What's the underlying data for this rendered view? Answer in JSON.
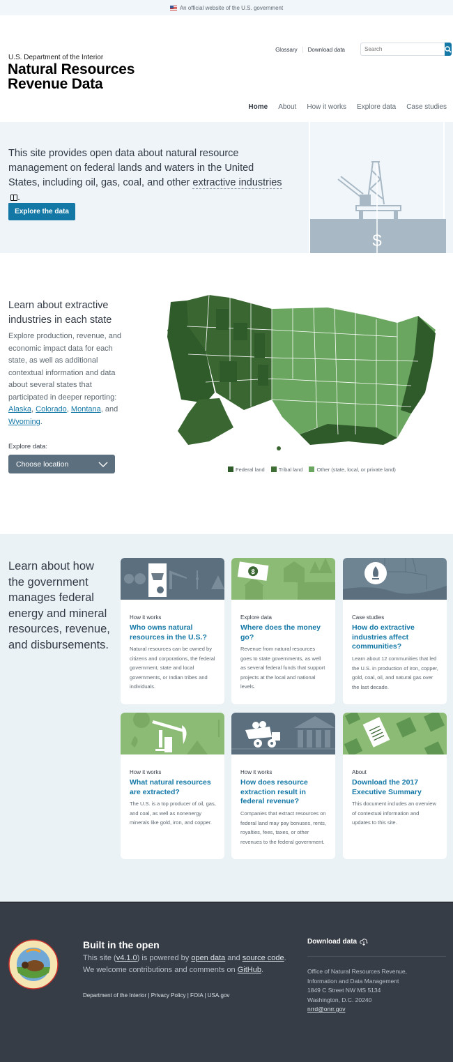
{
  "gov_banner": {
    "text": "An official website of the U.S. government"
  },
  "header": {
    "agency": "U.S. Department of the Interior",
    "title_line1": "Natural Resources",
    "title_line2": "Revenue Data",
    "utility_links": [
      "Glossary",
      "Download data"
    ],
    "search_placeholder": "Search",
    "nav": [
      {
        "label": "Home",
        "active": true
      },
      {
        "label": "About"
      },
      {
        "label": "How it works"
      },
      {
        "label": "Explore data"
      },
      {
        "label": "Case studies"
      }
    ]
  },
  "hero": {
    "text_before": "This site provides open data about natural resource management on federal lands and waters in the United States, including oil, gas, coal, and other ",
    "term": "extractive industries",
    "text_after": ".",
    "button": "Explore the data",
    "art_icon": "offshore-oil-rig-dollar"
  },
  "states": {
    "heading": "Learn about extractive industries in each state",
    "body_before": "Explore production, revenue, and economic impact data for each state, as well as additional contextual information and data about several states that participated in deeper reporting: ",
    "links": [
      "Alaska",
      "Colorado",
      "Montana",
      "Wyoming"
    ],
    "sep1": ", ",
    "sep2": ", ",
    "sep3": ", and ",
    "body_after": ".",
    "explore_label": "Explore data:",
    "select_value": "Choose location",
    "legend": [
      {
        "label": "Federal land",
        "color": "#2f5a2a"
      },
      {
        "label": "Tribal land",
        "color": "#3f6f35"
      },
      {
        "label": "Other (state, local, or private land)",
        "color": "#6aa660"
      }
    ]
  },
  "manage": {
    "heading": "Learn about how the government manages federal energy and mineral resources, revenue, and disbursements.",
    "cards": [
      {
        "category": "How it works",
        "title": "Who owns natural resources in the U.S.?",
        "desc": "Natural resources can be owned by citizens and corporations, the federal government, state and local governments, or Indian tribes and individuals."
      },
      {
        "category": "Explore data",
        "title": "Where does the money go?",
        "desc": "Revenue from natural resources goes to state governments, as well as several federal funds that support projects at the local and national levels."
      },
      {
        "category": "Case studies",
        "title": "How do extractive industries affect communities?",
        "desc": "Learn about 12 communities that led the U.S. in production of iron, copper, gold, coal, oil, and natural gas over the last decade."
      },
      {
        "category": "How it works",
        "title": "What natural resources are extracted?",
        "desc": "The U.S. is a top producer of oil, gas, and coal, as well as nonenergy minerals like gold, iron, and copper."
      },
      {
        "category": "How it works",
        "title": "How does resource extraction result in federal revenue?",
        "desc": "Companies that extract resources on federal land may pay bonuses, rents, royalties, fees, taxes, or other revenues to the federal government."
      },
      {
        "category": "About",
        "title": "Download the 2017 Executive Summary",
        "desc": "This document includes an overview of contextual information and updates to this site."
      }
    ]
  },
  "footer": {
    "built_title": "Built in the open",
    "built_1": "This site (",
    "version": "v4.1.0",
    "built_2": ") is powered by ",
    "open_data": "open data",
    "built_3": " and ",
    "source_code": "source code",
    "built_4": ". We welcome contributions and comments on ",
    "github": "GitHub",
    "built_5": ".",
    "links": [
      "Department of the Interior",
      "Privacy Policy",
      "FOIA",
      "USA.gov"
    ],
    "download_title": "Download data",
    "address": [
      "Office of Natural Resources Revenue,",
      "Information and Data Management",
      "1849 C Street NW MS 5134",
      "Washington, D.C. 20240"
    ],
    "email": "nrrd@onrr.gov"
  },
  "colors": {
    "accent": "#1478a6",
    "footer_bg": "#373d46",
    "light_bg": "#eef4f8"
  }
}
